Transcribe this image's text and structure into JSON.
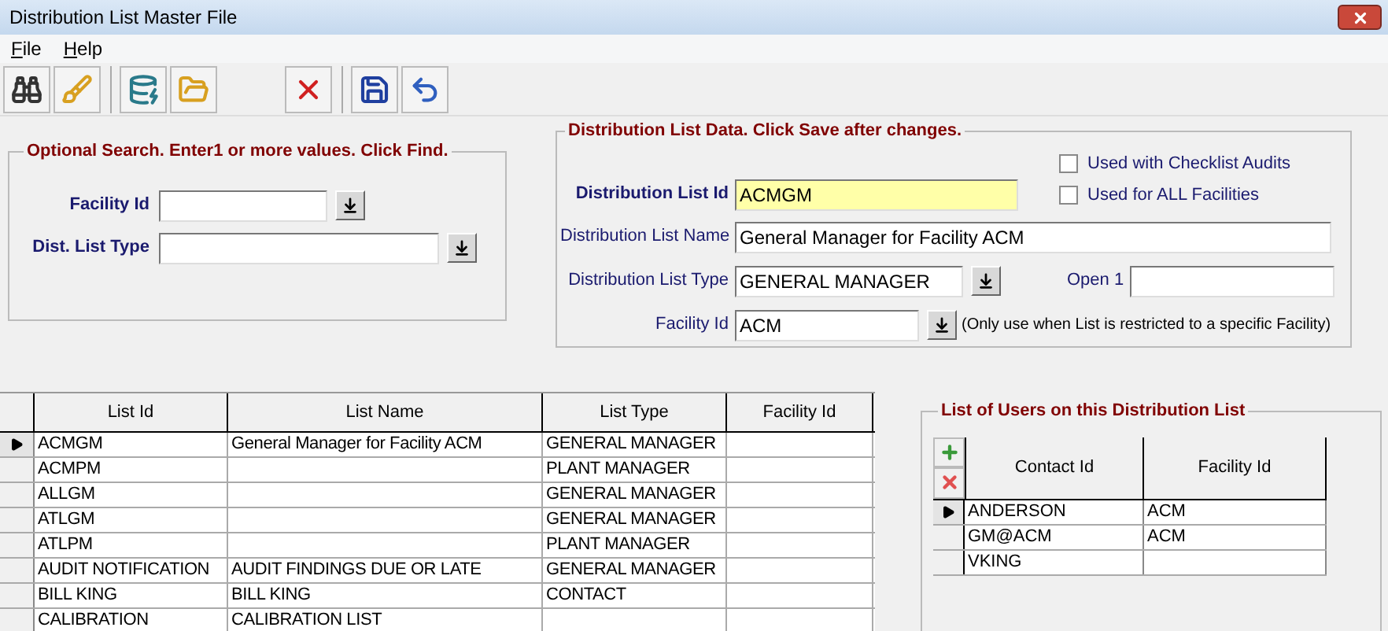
{
  "window": {
    "title": "Distribution List Master File"
  },
  "menu": [
    {
      "label": "File"
    },
    {
      "label": "Help"
    }
  ],
  "toolbar": [
    [
      {
        "kind": "find"
      },
      {
        "kind": "clear"
      }
    ],
    [
      {
        "kind": "add"
      },
      {
        "kind": "open"
      }
    ],
    [
      {
        "kind": "delete"
      }
    ],
    [
      {
        "kind": "save"
      },
      {
        "kind": "undo"
      }
    ]
  ],
  "search": {
    "legend": "Optional Search.  Enter1 or more values. Click Find.",
    "facility_label": "Facility Id",
    "type_label": "Dist. List Type"
  },
  "data": {
    "legend": "Distribution List Data.  Click Save after changes.",
    "checkboxes": [
      {
        "label": "Used with Checklist Audits",
        "checked": false
      },
      {
        "label": "Used for ALL Facilities",
        "checked": false
      }
    ],
    "id_label": "Distribution List Id",
    "id_value": "ACMGM",
    "name_label": "Distribution List Name",
    "name_value": "General Manager for Facility ACM",
    "type_label": "Distribution List Type",
    "type_value": "GENERAL MANAGER",
    "open_label": "Open 1",
    "facility_label": "Facility Id",
    "facility_value": "ACM",
    "facility_note": "(Only use when List is restricted to a specific Facility)"
  },
  "table": {
    "columns": [
      "List Id",
      "List Name",
      "List Type",
      "Facility Id"
    ],
    "rows": [
      {
        "selected": true,
        "cells": [
          "ACMGM",
          "General Manager for Facility ACM",
          "GENERAL MANAGER"
        ]
      },
      {
        "selected": false,
        "cells": [
          "ACMPM",
          "",
          "PLANT MANAGER"
        ]
      },
      {
        "selected": false,
        "cells": [
          "ALLGM",
          "",
          "GENERAL MANAGER"
        ]
      },
      {
        "selected": false,
        "cells": [
          "ATLGM",
          "",
          "GENERAL MANAGER"
        ]
      },
      {
        "selected": false,
        "cells": [
          "ATLPM",
          "",
          "PLANT MANAGER"
        ]
      },
      {
        "selected": false,
        "cells": [
          "AUDIT NOTIFICATION",
          "AUDIT FINDINGS DUE OR LATE",
          "GENERAL MANAGER"
        ]
      },
      {
        "selected": false,
        "cells": [
          "BILL KING",
          "BILL KING",
          "CONTACT"
        ]
      },
      {
        "selected": false,
        "cells": [
          "CALIBRATION",
          "CALIBRATION LIST"
        ]
      }
    ]
  },
  "users": {
    "legend": "List of Users on this Distribution List",
    "columns": [
      "Contact Id",
      "Facility Id"
    ],
    "rows": [
      {
        "selected": true,
        "cells": [
          "ANDERSON",
          "ACM"
        ]
      },
      {
        "selected": false,
        "cells": [
          "GM@ACM",
          "ACM"
        ]
      },
      {
        "selected": false,
        "cells": [
          "VKING"
        ]
      }
    ]
  }
}
